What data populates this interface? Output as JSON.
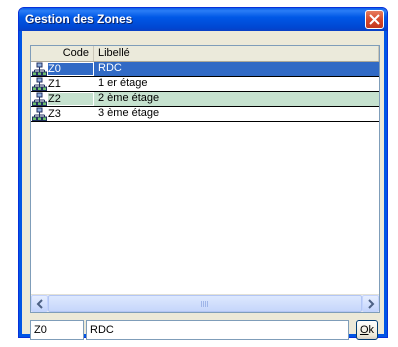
{
  "window": {
    "title": "Gestion des Zones"
  },
  "grid": {
    "columns": [
      "Code",
      "Libellé"
    ],
    "rows": [
      {
        "code": "Z0",
        "label": "RDC",
        "state": "selected"
      },
      {
        "code": "Z1",
        "label": "1 er étage",
        "state": "normal"
      },
      {
        "code": "Z2",
        "label": "2 ème étage",
        "state": "alternate"
      },
      {
        "code": "Z3",
        "label": "3 ème étage",
        "state": "normal"
      }
    ],
    "row_icon": "zone-tree-icon"
  },
  "form": {
    "code_value": "Z0",
    "label_value": "RDC",
    "ok_label_underlined": "O",
    "ok_label_rest": "k"
  },
  "colors": {
    "selection": "#316ac5",
    "alternate_row": "#c6e2cf",
    "titlebar": "#0058e6"
  }
}
